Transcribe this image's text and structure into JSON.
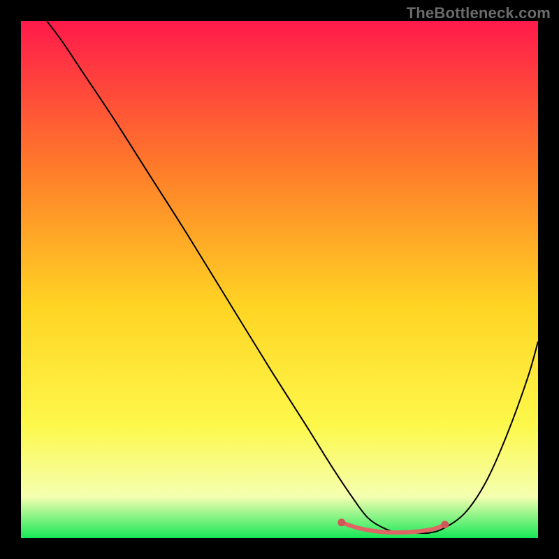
{
  "attribution": "TheBottleneck.com",
  "colors": {
    "grad_top": "#ff1a4b",
    "grad_upper_mid": "#ff7a2a",
    "grad_mid": "#ffd423",
    "grad_lower_mid": "#fdf84a",
    "grad_low": "#f5ffb0",
    "grad_bottom": "#17e858",
    "curve_stroke": "#000000",
    "marker_stroke": "#e06666",
    "marker_fill": "#d15858",
    "frame": "#000000"
  },
  "chart_data": {
    "type": "line",
    "title": "",
    "xlabel": "",
    "ylabel": "",
    "xlim": [
      0,
      100
    ],
    "ylim": [
      0,
      100
    ],
    "series": [
      {
        "name": "bottleneck-curve",
        "x": [
          5,
          8,
          12,
          18,
          25,
          32,
          40,
          48,
          55,
          60,
          64,
          67,
          70,
          73,
          76,
          79,
          82,
          86,
          90,
          94,
          98,
          100
        ],
        "y": [
          100,
          96,
          90,
          81,
          70,
          59,
          46,
          33,
          22,
          14,
          8,
          4,
          2,
          1,
          1,
          1,
          2,
          5,
          11,
          20,
          31,
          38
        ]
      }
    ],
    "highlight_range": {
      "name": "optimal-zone",
      "x": [
        62,
        65,
        68,
        71,
        74,
        77,
        80,
        82
      ],
      "y": [
        3.0,
        2.0,
        1.4,
        1.1,
        1.1,
        1.3,
        1.8,
        2.6
      ]
    },
    "gradient_stops": [
      {
        "pos": 0.0,
        "color": "#ff1a4b"
      },
      {
        "pos": 0.28,
        "color": "#ff7a2a"
      },
      {
        "pos": 0.55,
        "color": "#ffd423"
      },
      {
        "pos": 0.78,
        "color": "#fdf84a"
      },
      {
        "pos": 0.92,
        "color": "#f5ffb0"
      },
      {
        "pos": 1.0,
        "color": "#17e858"
      }
    ]
  }
}
